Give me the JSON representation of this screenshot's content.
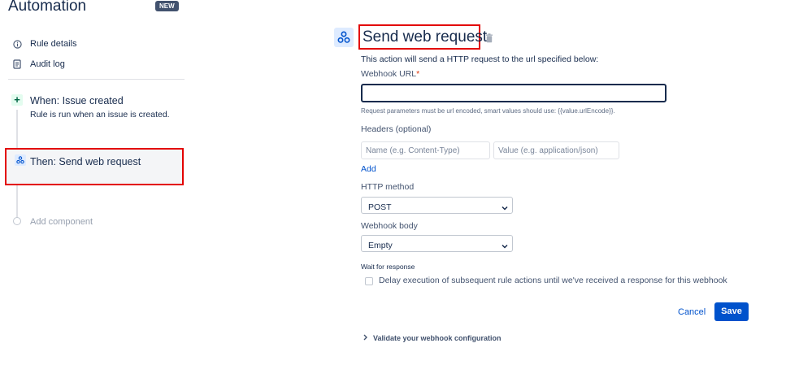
{
  "sidebar": {
    "title": "Automation",
    "badge": "NEW",
    "nav": [
      {
        "label": "Rule details",
        "icon": "info-icon"
      },
      {
        "label": "Audit log",
        "icon": "document-icon"
      }
    ],
    "trigger": {
      "title": "When: Issue created",
      "subtitle": "Rule is run when an issue is created.",
      "icon": "plus-icon"
    },
    "action": {
      "title": "Then: Send web request",
      "icon": "webhook-icon"
    },
    "add_component": "Add component"
  },
  "main": {
    "title": "Send web request",
    "description": "This action will send a HTTP request to the url specified below:",
    "webhook_url": {
      "label": "Webhook URL",
      "required_mark": "*",
      "value": "",
      "help": "Request parameters must be url encoded, smart values should use: {{value.urlEncode}}."
    },
    "headers": {
      "label": "Headers (optional)",
      "name_placeholder": "Name (e.g. Content-Type)",
      "value_placeholder": "Value (e.g. application/json)",
      "add_label": "Add"
    },
    "http_method": {
      "label": "HTTP method",
      "selected": "POST"
    },
    "webhook_body": {
      "label": "Webhook body",
      "selected": "Empty"
    },
    "wait": {
      "label": "Wait for response",
      "checkbox_text": "Delay execution of subsequent rule actions until we've received a response for this webhook",
      "checked": false
    },
    "cancel_label": "Cancel",
    "save_label": "Save",
    "validate_label": "Validate your webhook configuration"
  },
  "colors": {
    "accent": "#0052cc",
    "highlight_border": "#e30000",
    "badge_bg": "#42526e",
    "trigger_bg": "#e3fcef"
  }
}
